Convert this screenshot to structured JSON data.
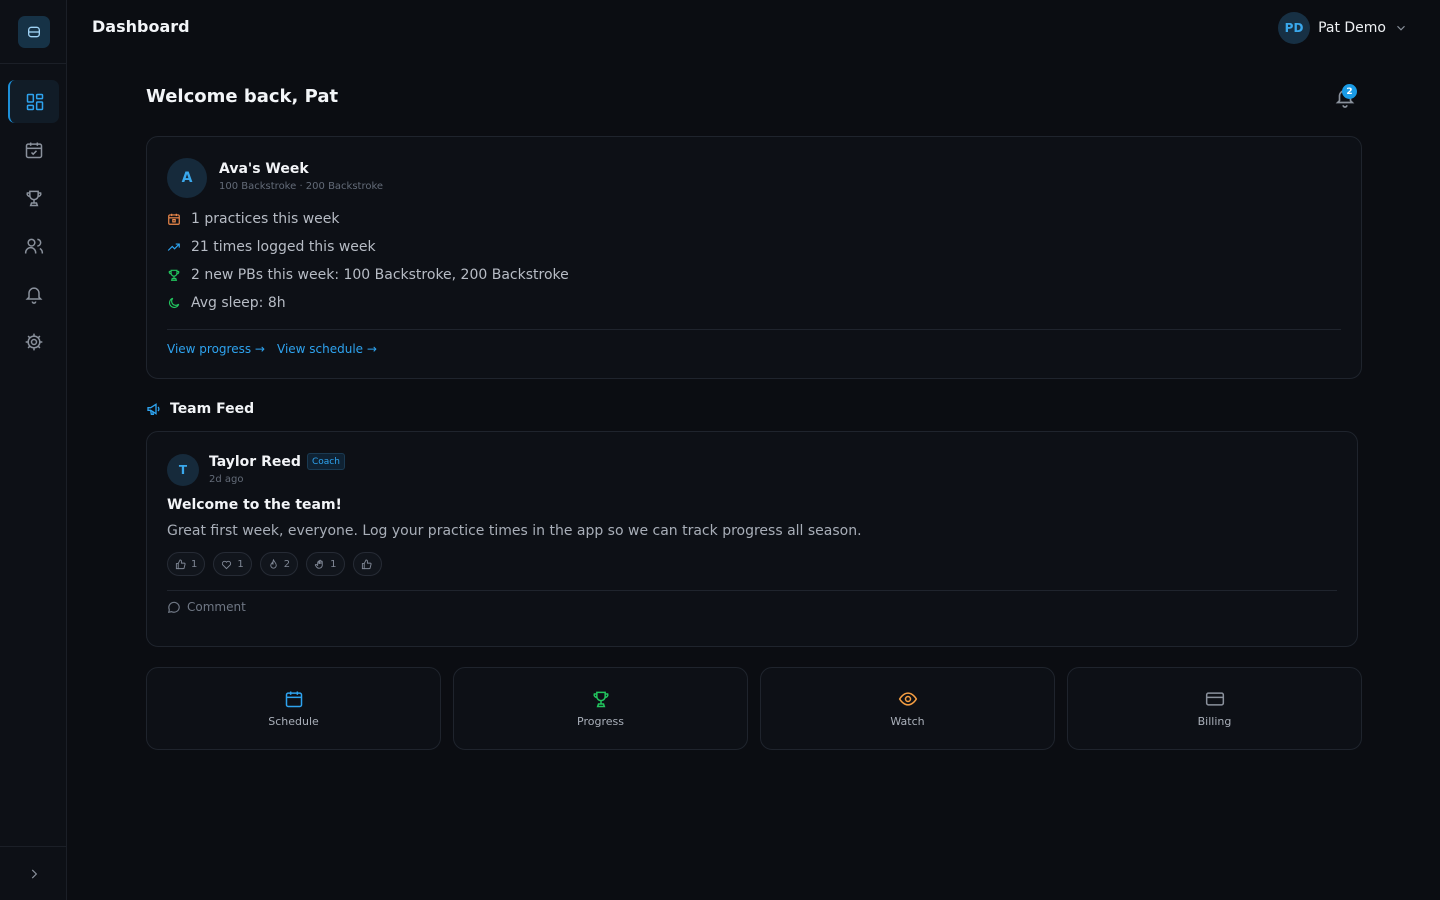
{
  "header": {
    "title": "Dashboard"
  },
  "user": {
    "initials": "PD",
    "name": "Pat Demo"
  },
  "welcome": "Welcome back, Pat",
  "notifications": {
    "count": "2"
  },
  "week_card": {
    "avatar": "A",
    "title": "Ava's Week",
    "subtitle": "100 Backstroke · 200 Backstroke",
    "stats": [
      {
        "icon": "calendar-icon",
        "text": "1 practices this week"
      },
      {
        "icon": "trending-up-icon",
        "text": "21 times logged this week"
      },
      {
        "icon": "trophy-icon",
        "text": "2 new PBs this week: 100 Backstroke, 200 Backstroke"
      },
      {
        "icon": "moon-icon",
        "text": "Avg sleep: 8h"
      }
    ],
    "links": {
      "progress": "View progress →",
      "schedule": "View schedule →"
    }
  },
  "feed": {
    "title": "Team Feed",
    "post": {
      "avatar": "T",
      "author": "Taylor Reed",
      "role": "Coach",
      "time": "2d ago",
      "title": "Welcome to the team!",
      "body": "Great first week, everyone. Log your practice times in the app so we can track progress all season.",
      "reactions": [
        {
          "icon": "thumbs-up-icon",
          "count": "1"
        },
        {
          "icon": "heart-icon",
          "count": "1"
        },
        {
          "icon": "flame-icon",
          "count": "2"
        },
        {
          "icon": "clap-icon",
          "count": "1"
        },
        {
          "icon": "add-reaction-icon",
          "count": ""
        }
      ],
      "comment_label": "Comment"
    }
  },
  "quick_links": [
    {
      "label": "Schedule",
      "icon": "calendar-icon",
      "color": "#2ea3ef"
    },
    {
      "label": "Progress",
      "icon": "trophy-icon",
      "color": "#22c55e"
    },
    {
      "label": "Watch",
      "icon": "eye-icon",
      "color": "#f59e42"
    },
    {
      "label": "Billing",
      "icon": "credit-card-icon",
      "color": "#8a919c"
    }
  ],
  "colors": {
    "accent": "#1d8fd8",
    "background": "#0b0d12",
    "card": "#0d1016",
    "border": "#1f242d"
  }
}
